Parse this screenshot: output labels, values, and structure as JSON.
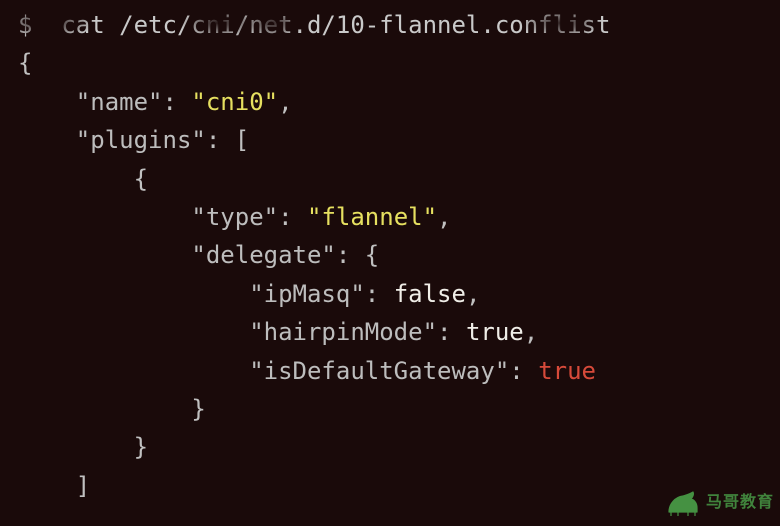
{
  "prompt_line": "$  cat /etc/cni/net.d/10-flannel.conflist",
  "json": {
    "open": "{",
    "name_key": "\"name\"",
    "name_val": "\"cni0\"",
    "plugins_key": "\"plugins\"",
    "plugins_open": "[",
    "item_open": "{",
    "type_key": "\"type\"",
    "type_val": "\"flannel\"",
    "delegate_key": "\"delegate\"",
    "delegate_open": "{",
    "ipMasq_key": "\"ipMasq\"",
    "ipMasq_val": "false",
    "hairpin_key": "\"hairpinMode\"",
    "hairpin_val": "true",
    "gateway_key": "\"isDefaultGateway\"",
    "gateway_val": "true",
    "delegate_close": "}",
    "item_close": "}",
    "plugins_close": "]"
  },
  "watermark": {
    "text": "马哥教育"
  }
}
